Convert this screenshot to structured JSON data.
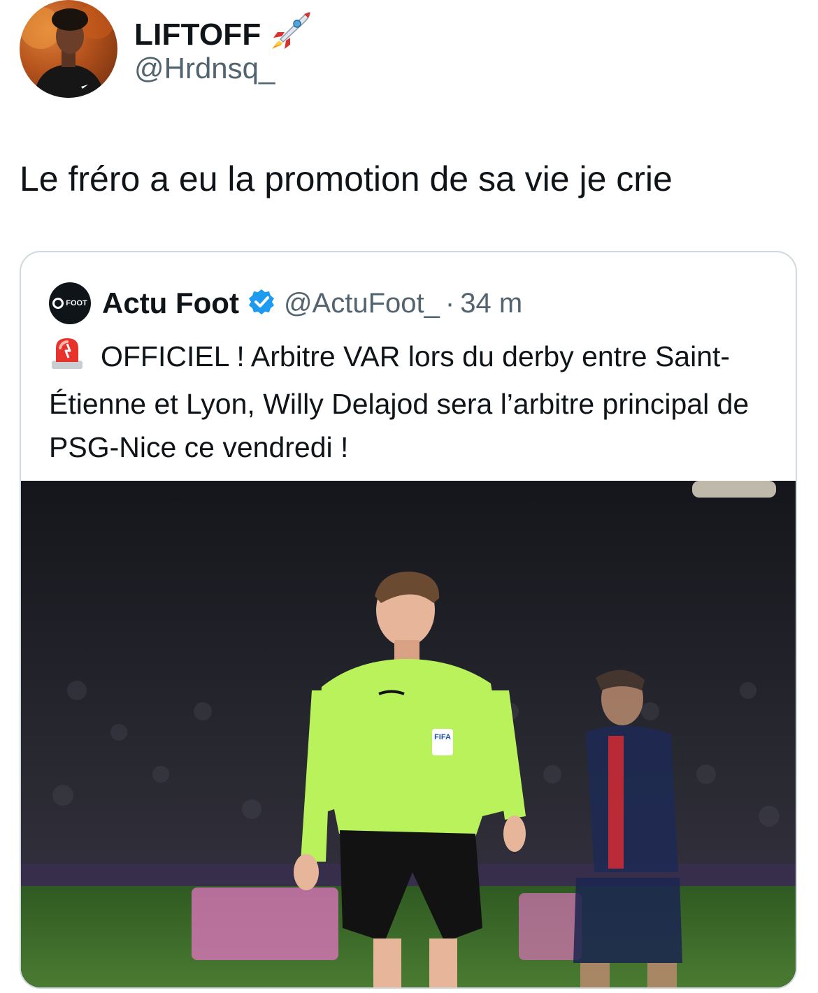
{
  "author": {
    "display_name": "LIFTOFF",
    "name_emoji": "rocket-icon",
    "handle": "@Hrdnsq_"
  },
  "tweet": {
    "text": "Le fréro a eu la promotion de sa vie je crie"
  },
  "quoted_tweet": {
    "logo_text": "FOOT",
    "display_name": "Actu Foot",
    "verified": true,
    "handle": "@ActuFoot_",
    "separator": "·",
    "time": "34 m",
    "emoji": "siren-icon",
    "text": "OFFICIEL ! Arbitre VAR lors du derby entre Saint-Étienne et Lyon, Willy Delajod sera l’arbitre principal de PSG-Nice ce vendredi !",
    "photo": {
      "badge_text": "FIFA",
      "colors": {
        "kit": "#b9f25a",
        "psg": "#1e2a55",
        "pitch": "#3a6b2a"
      }
    }
  }
}
